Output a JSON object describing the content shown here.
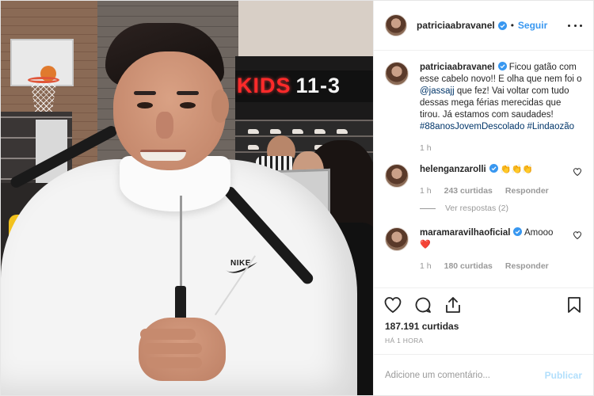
{
  "header": {
    "username": "patriciaabravanel",
    "separator": "•",
    "follow_label": "Seguir"
  },
  "photo": {
    "sign_kids": "KIDS",
    "sign_size": "11-3",
    "jacket_brand": "NIKE"
  },
  "caption": {
    "username": "patriciaabravanel",
    "text_before_mention": " Ficou gatão com esse cabelo novo!! E olha que nem foi o ",
    "mention": "@jassajj",
    "text_after_mention": " que fez! Vai voltar com tudo dessas mega férias merecidas que tirou. Já estamos com saudades! ",
    "hashtags": "#88anosJovemDescolado #Lindaozão",
    "time": "1 h"
  },
  "comments": [
    {
      "username": "helenganzarolli",
      "text": "👏👏👏",
      "time": "1 h",
      "likes": "243 curtidas",
      "reply_label": "Responder",
      "view_replies": "Ver respostas (2)"
    },
    {
      "username": "maramaravilhaoficial",
      "text": " Amooo",
      "emoji": "❤️",
      "time": "1 h",
      "likes": "180 curtidas",
      "reply_label": "Responder"
    }
  ],
  "engagement": {
    "likes": "187.191 curtidas",
    "time_ago": "HÁ 1 HORA"
  },
  "add_comment": {
    "placeholder": "Adicione um comentário...",
    "publish_label": "Publicar"
  },
  "colors": {
    "accent_blue": "#3897f0",
    "publish_disabled": "#b2dffc",
    "hashtag": "#003569",
    "heart_red": "#ed4956",
    "meta_gray": "#999999"
  },
  "icons": {
    "more": "more-options-icon",
    "verified": "verified-badge-icon",
    "like": "heart-icon",
    "comment": "comment-bubble-icon",
    "share": "share-icon",
    "save": "bookmark-icon"
  }
}
